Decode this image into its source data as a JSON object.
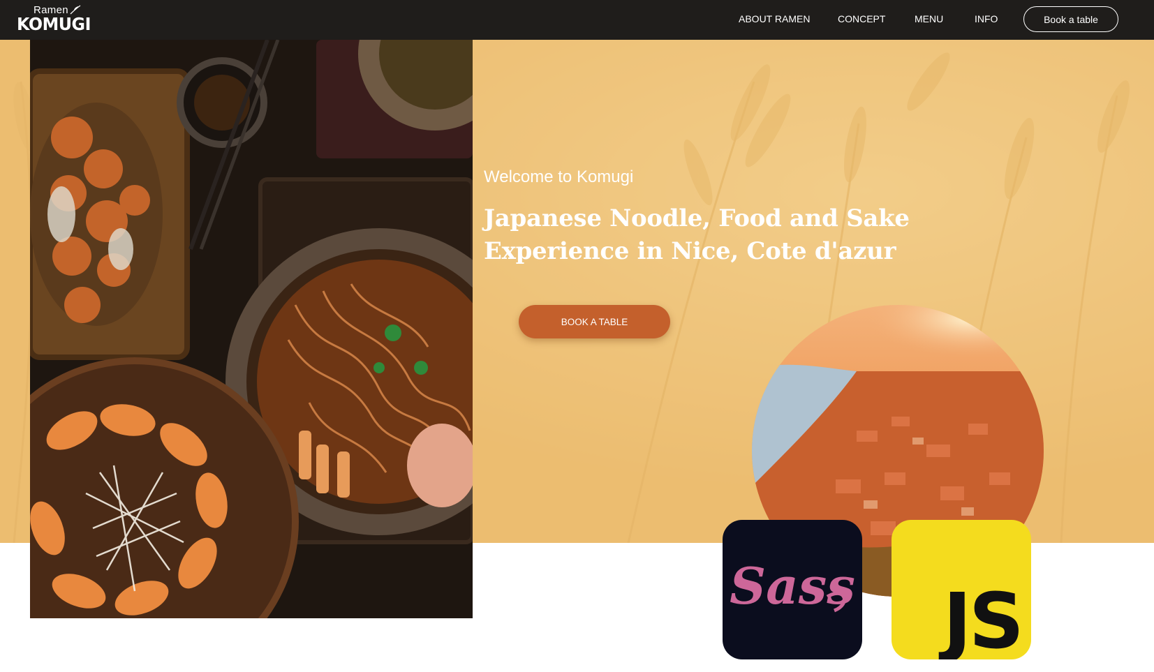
{
  "brand": {
    "small": "Ramen",
    "name": "KOMUGI"
  },
  "nav": {
    "items": [
      {
        "label": "ABOUT RAMEN"
      },
      {
        "label": "CONCEPT"
      },
      {
        "label": "MENU"
      },
      {
        "label": "INFO"
      }
    ],
    "cta_label": "Book a table"
  },
  "hero": {
    "welcome": "Welcome to Komugi",
    "headline": "Japanese Noodle, Food and Sake Experience in Nice, Cote d'azur",
    "cta_label": "BOOK A TABLE"
  },
  "badges": {
    "sass_text": "Sass",
    "js_text": "JS"
  },
  "colors": {
    "nav_bg": "#1f1d1b",
    "hero_bg": "#efc37a",
    "cta_bg": "#c4602c",
    "sass_pink": "#cd6799",
    "js_yellow": "#f4dc1e"
  }
}
